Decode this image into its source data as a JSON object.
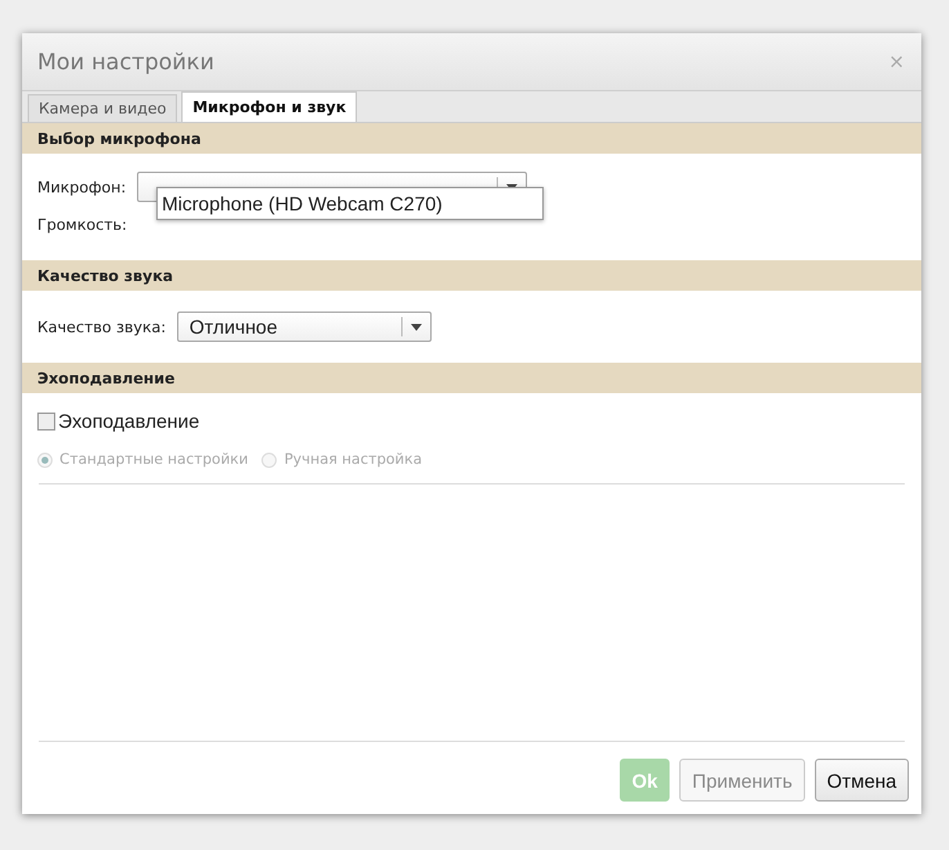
{
  "dialog": {
    "title": "Мои настройки",
    "close": "×"
  },
  "tabs": [
    {
      "label": "Камера и видео",
      "selected": false
    },
    {
      "label": "Микрофон и звук",
      "selected": true
    }
  ],
  "microphone_section": {
    "title": "Выбор микрофона",
    "microphone": {
      "label": "Микрофон:",
      "expanded": true,
      "options": [
        "Microphone (HD Webcam C270)"
      ]
    },
    "volume": {
      "label": "Громкость:"
    }
  },
  "quality_section": {
    "title": "Качество звука",
    "quality": {
      "label": "Качество звука:",
      "value": "Отличное"
    }
  },
  "echo_section": {
    "title": "Эхоподавление",
    "echo_cancellation": {
      "label": "Эхоподавление",
      "checked": false
    },
    "modes": [
      {
        "label": "Стандартные настройки",
        "selected": true,
        "disabled": true
      },
      {
        "label": "Ручная настройка",
        "selected": false,
        "disabled": true
      }
    ]
  },
  "buttons": [
    {
      "label": "Ok",
      "kind": "primary",
      "disabled": true
    },
    {
      "label": "Применить",
      "kind": "normal",
      "disabled": true
    },
    {
      "label": "Отмена",
      "kind": "normal",
      "disabled": false
    }
  ]
}
